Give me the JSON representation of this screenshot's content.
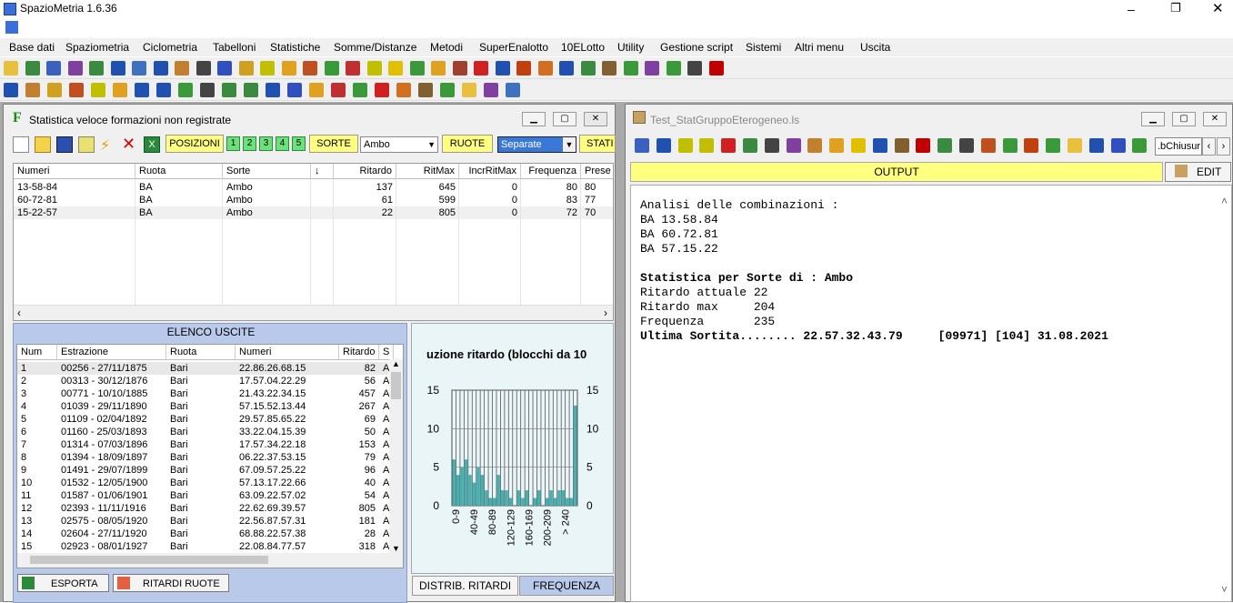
{
  "app": {
    "title": "SpazioMetria  1.6.36"
  },
  "menu": [
    "Base dati",
    "Spaziometria",
    "Ciclometria",
    "Tabelloni",
    "Statistiche",
    "Somme/Distanze",
    "Metodi",
    "SuperEnalotto",
    "10ELotto",
    "Utility",
    "Gestione script",
    "Sistemi",
    "Altri menu",
    "Uscita"
  ],
  "left": {
    "title": "Statistica veloce formazioni non registrate",
    "toolbar": {
      "posizioni": "POSIZIONI",
      "pos": [
        "1",
        "2",
        "3",
        "4",
        "5"
      ],
      "sorte": "SORTE",
      "sorte_value": "Ambo",
      "ruote": "RUOTE",
      "ruote_value": "Separate",
      "stat": "STATI"
    },
    "columns": [
      "Numeri",
      "Ruota",
      "Sorte",
      "↓",
      "Ritardo",
      "RitMax",
      "IncrRitMax",
      "Frequenza",
      "Prese"
    ],
    "rows": [
      [
        "13-58-84",
        "BA",
        "Ambo",
        "",
        "137",
        "645",
        "0",
        "80",
        "80"
      ],
      [
        "60-72-81",
        "BA",
        "Ambo",
        "",
        "61",
        "599",
        "0",
        "83",
        "77"
      ],
      [
        "15-22-57",
        "BA",
        "Ambo",
        "",
        "22",
        "805",
        "0",
        "72",
        "70"
      ]
    ],
    "elenco": {
      "title": "ELENCO USCITE",
      "columns": [
        "Num",
        "Estrazione",
        "Ruota",
        "Numeri",
        "Ritardo",
        "S"
      ],
      "rows": [
        [
          "1",
          "00256 - 27/11/1875",
          "Bari",
          "22.86.26.68.15",
          "82",
          "A"
        ],
        [
          "2",
          "00313 - 30/12/1876",
          "Bari",
          "17.57.04.22.29",
          "56",
          "A"
        ],
        [
          "3",
          "00771 - 10/10/1885",
          "Bari",
          "21.43.22.34.15",
          "457",
          "A"
        ],
        [
          "4",
          "01039 - 29/11/1890",
          "Bari",
          "57.15.52.13.44",
          "267",
          "A"
        ],
        [
          "5",
          "01109 - 02/04/1892",
          "Bari",
          "29.57.85.65.22",
          "69",
          "A"
        ],
        [
          "6",
          "01160 - 25/03/1893",
          "Bari",
          "33.22.04.15.39",
          "50",
          "A"
        ],
        [
          "7",
          "01314 - 07/03/1896",
          "Bari",
          "17.57.34.22.18",
          "153",
          "A"
        ],
        [
          "8",
          "01394 - 18/09/1897",
          "Bari",
          "06.22.37.53.15",
          "79",
          "A"
        ],
        [
          "9",
          "01491 - 29/07/1899",
          "Bari",
          "67.09.57.25.22",
          "96",
          "A"
        ],
        [
          "10",
          "01532 - 12/05/1900",
          "Bari",
          "57.13.17.22.66",
          "40",
          "A"
        ],
        [
          "11",
          "01587 - 01/06/1901",
          "Bari",
          "63.09.22.57.02",
          "54",
          "A"
        ],
        [
          "12",
          "02393 - 11/11/1916",
          "Bari",
          "22.62.69.39.57",
          "805",
          "A"
        ],
        [
          "13",
          "02575 - 08/05/1920",
          "Bari",
          "22.56.87.57.31",
          "181",
          "A"
        ],
        [
          "14",
          "02604 - 27/11/1920",
          "Bari",
          "68.88.22.57.38",
          "28",
          "A"
        ],
        [
          "15",
          "02923 - 08/01/1927",
          "Bari",
          "22.08.84.77.57",
          "318",
          "A"
        ]
      ],
      "esporta": "ESPORTA",
      "ritardi_ruote": "RITARDI RUOTE"
    },
    "tabs": [
      "DISTRIB. RITARDI",
      "FREQUENZA"
    ]
  },
  "chart_data": {
    "type": "bar",
    "title": "uzione ritardo (blocchi da 10",
    "ylim": [
      0,
      15
    ],
    "yticks": [
      "0",
      "5",
      "10",
      "15"
    ],
    "xticks": [
      "0-9",
      "40-49",
      "80-89",
      "120-129",
      "160-169",
      "200-209",
      "> 240"
    ],
    "values": [
      6,
      4,
      5,
      6,
      4,
      3,
      5,
      4,
      2,
      1,
      1,
      4,
      2,
      2,
      1,
      0,
      2,
      1,
      2,
      0,
      1,
      2,
      0,
      1,
      2,
      1,
      2,
      2,
      1,
      1,
      13
    ]
  },
  "right": {
    "title": "Test_StatGruppoEterogeneo.ls",
    "combo": ".bChiusur",
    "output_label": "OUTPUT",
    "edit_label": "EDIT",
    "lines": [
      {
        "t": "Analisi delle combinazioni :",
        "b": false
      },
      {
        "t": "BA 13.58.84",
        "b": false
      },
      {
        "t": "BA 60.72.81",
        "b": false
      },
      {
        "t": "BA 57.15.22",
        "b": false
      },
      {
        "t": "",
        "b": false
      },
      {
        "t": "Statistica per Sorte di : Ambo",
        "b": true
      },
      {
        "t": "Ritardo attuale 22",
        "b": false
      },
      {
        "t": "Ritardo max     204",
        "b": false
      },
      {
        "t": "Frequenza       235",
        "b": false
      },
      {
        "t": "Ultima Sortita........ 22.57.32.43.79     [09971] [104] 31.08.2021",
        "b": true
      }
    ]
  }
}
